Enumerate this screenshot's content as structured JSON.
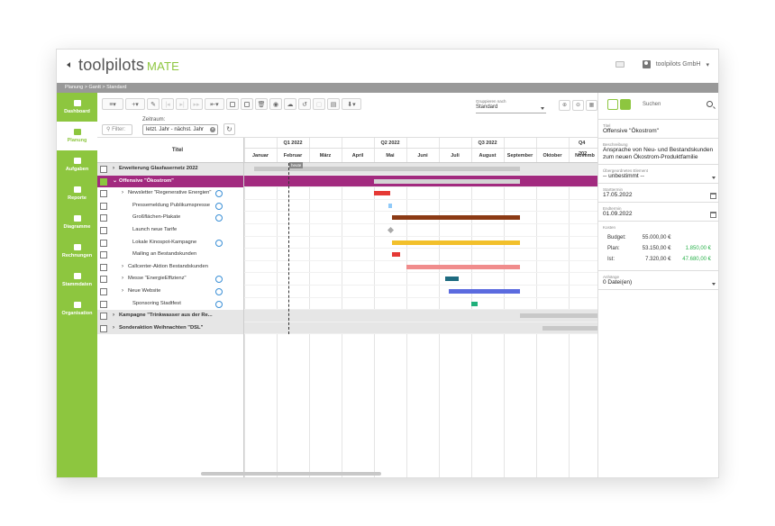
{
  "app": {
    "logo_main": "toolpilots",
    "logo_accent": "MATE",
    "company": "toolpilots GmbH"
  },
  "breadcrumb": "Planung  >  Gantt  >  Standard",
  "nav": [
    {
      "label": "Dashboard",
      "icon": "home-icon",
      "active": false
    },
    {
      "label": "Planung",
      "icon": "planning-icon",
      "active": true
    },
    {
      "label": "Aufgaben",
      "icon": "tasks-icon",
      "active": false
    },
    {
      "label": "Reporte",
      "icon": "reports-icon",
      "active": false
    },
    {
      "label": "Diagramme",
      "icon": "pie-chart-icon",
      "active": false
    },
    {
      "label": "Rechnungen",
      "icon": "invoice-icon",
      "active": false
    },
    {
      "label": "Stammdaten",
      "icon": "master-data-icon",
      "active": false
    },
    {
      "label": "Organisation",
      "icon": "organization-icon",
      "active": false
    }
  ],
  "toolbar": {
    "gruppieren_label": "Gruppieren nach",
    "gruppieren_value": "Standard",
    "filter_label": "Filter:",
    "zeitraum_label": "Zeitraum:",
    "zeitraum_value": "letzt. Jahr - nächst. Jahr"
  },
  "table": {
    "title_header": "Titel"
  },
  "timeline": {
    "quarters": [
      "Q1 2022",
      "Q2 2022",
      "Q3 2022",
      "Q4 202"
    ],
    "months": [
      "Januar",
      "Februar",
      "März",
      "April",
      "Mai",
      "Juni",
      "Juli",
      "August",
      "September",
      "Oktober",
      "Novemb"
    ],
    "today_label": "heute"
  },
  "rows": [
    {
      "title": "Erweiterung Glasfasernetz 2022",
      "kind": "group",
      "chevron": ">",
      "bar": {
        "start": 0.3,
        "end": 8.5,
        "color": "#c8c8c8"
      }
    },
    {
      "title": "Offensive \"Ökostrom\"",
      "kind": "selected",
      "chevron": "v",
      "bar": {
        "start": 4.0,
        "end": 8.5,
        "color": "#d4d4d4"
      }
    },
    {
      "title": "Newsletter \"Regenerative Energien\"",
      "kind": "item",
      "chevron": ">",
      "indent": 2,
      "circle": true,
      "bar": {
        "start": 4.0,
        "end": 4.5,
        "color": "#e53935"
      }
    },
    {
      "title": "Pressemeldung Publikumspresse",
      "kind": "item",
      "indent": 3,
      "circle": true,
      "bar": {
        "start": 4.45,
        "end": 4.55,
        "color": "#90caf9"
      }
    },
    {
      "title": "Großflächen-Plakate",
      "kind": "item",
      "indent": 3,
      "circle": true,
      "bar": {
        "start": 4.55,
        "end": 8.5,
        "color": "#8b3a14"
      }
    },
    {
      "title": "Launch neue Tarife",
      "kind": "item",
      "indent": 3,
      "circle": false,
      "milestone": 4.5
    },
    {
      "title": "Lokale Kinospot-Kampagne",
      "kind": "item",
      "indent": 3,
      "circle": true,
      "bar": {
        "start": 4.55,
        "end": 8.5,
        "color": "#f2c02b"
      }
    },
    {
      "title": "Mailing an Bestandskunden",
      "kind": "item",
      "indent": 3,
      "circle": false,
      "bar": {
        "start": 4.55,
        "end": 4.8,
        "color": "#e53935"
      }
    },
    {
      "title": "Callcenter-Aktion Bestandskunden",
      "kind": "item",
      "chevron": ">",
      "indent": 2,
      "circle": false,
      "bar": {
        "start": 5.0,
        "end": 8.5,
        "color": "#f08c8c"
      }
    },
    {
      "title": "Messe \"EnergieEffizienz\"",
      "kind": "item",
      "chevron": ">",
      "indent": 2,
      "circle": true,
      "bar": {
        "start": 6.2,
        "end": 6.6,
        "color": "#1e6b80"
      }
    },
    {
      "title": "Neue Website",
      "kind": "item",
      "chevron": ">",
      "indent": 2,
      "circle": true,
      "bar": {
        "start": 6.3,
        "end": 8.5,
        "color": "#5b6bdf"
      }
    },
    {
      "title": "Sponsoring Stadtfest",
      "kind": "item",
      "indent": 3,
      "circle": true,
      "bar": {
        "start": 7.0,
        "end": 7.2,
        "color": "#20b07b"
      }
    },
    {
      "title": "Kampagne \"Trinkwasser aus der Re...",
      "kind": "group",
      "chevron": ">",
      "bar": {
        "start": 8.5,
        "end": 11.0,
        "color": "#c8c8c8"
      }
    },
    {
      "title": "Sonderaktion Weihnachten \"DSL\"",
      "kind": "group",
      "chevron": ">",
      "bar": {
        "start": 9.2,
        "end": 11.0,
        "color": "#c8c8c8"
      }
    }
  ],
  "detail": {
    "search_placeholder": "Suchen",
    "titel_label": "Titel",
    "titel_value": "Offensive \"Ökostrom\"",
    "beschreibung_label": "Beschreibung",
    "beschreibung_value": "Ansprache von Neu- und Bestandskunden zum neuen Ökostrom-Produktfamilie",
    "uebergeordnet_label": "Übergeordnetes Element",
    "uebergeordnet_value": "-- unbestimmt --",
    "starttermin_label": "Starttermin",
    "starttermin_value": "17.05.2022",
    "endtermin_label": "Endtermin",
    "endtermin_value": "01.09.2022",
    "kosten_label": "Kosten",
    "costs": [
      {
        "label": "Budget:",
        "value": "55.000,00 €",
        "diff": ""
      },
      {
        "label": "Plan:",
        "value": "53.150,00 €",
        "diff": "1.850,00 €"
      },
      {
        "label": "Ist:",
        "value": "7.320,00 €",
        "diff": "47.680,00 €"
      }
    ],
    "anhaenge_label": "Anhänge",
    "anhaenge_value": "0 Datei(en)"
  }
}
